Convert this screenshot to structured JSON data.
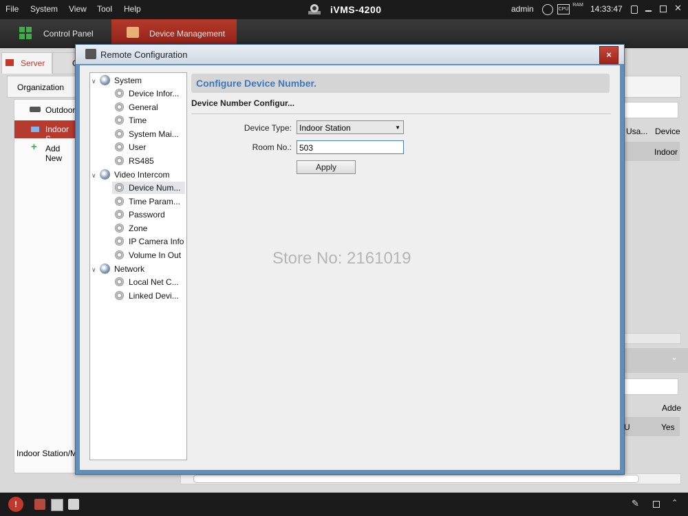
{
  "menu": {
    "file": "File",
    "system": "System",
    "view": "View",
    "tool": "Tool",
    "help": "Help"
  },
  "app_title": "iVMS-4200",
  "top_right": {
    "user": "admin",
    "cpu": "CPU",
    "ram": "RAM",
    "clock": "14:33:47"
  },
  "main_tabs": {
    "control_panel": "Control Panel",
    "device_management": "Device Management"
  },
  "background": {
    "sub_tab_server": "Server",
    "sub_tab_partial": "G",
    "organization": "Organization",
    "org_items": [
      "Outdoor",
      "Indoor S",
      "Add New"
    ],
    "footer_text": "Indoor Station/M",
    "col_headers": [
      "Usa...",
      "Device"
    ],
    "row_value": "Indoor",
    "lower_headers": [
      "Adde"
    ],
    "lower_row": [
      "U",
      "Yes"
    ]
  },
  "dialog": {
    "title": "Remote Configuration",
    "close": "×",
    "tree": {
      "system": {
        "label": "System",
        "children": [
          "Device Infor...",
          "General",
          "Time",
          "System Mai...",
          "User",
          "RS485"
        ]
      },
      "video_intercom": {
        "label": "Video Intercom",
        "children": [
          "Device Num...",
          "Time Param...",
          "Password",
          "Zone",
          "IP Camera Info",
          "Volume In Out"
        ]
      },
      "network": {
        "label": "Network",
        "children": [
          "Local Net C...",
          "Linked Devi..."
        ]
      }
    },
    "header": "Configure Device Number.",
    "section": "Device Number Configur...",
    "device_type_label": "Device Type:",
    "device_type_value": "Indoor Station",
    "room_no_label": "Room No.:",
    "room_no_value": "503",
    "apply": "Apply"
  },
  "watermark": "Store No: 2161019"
}
